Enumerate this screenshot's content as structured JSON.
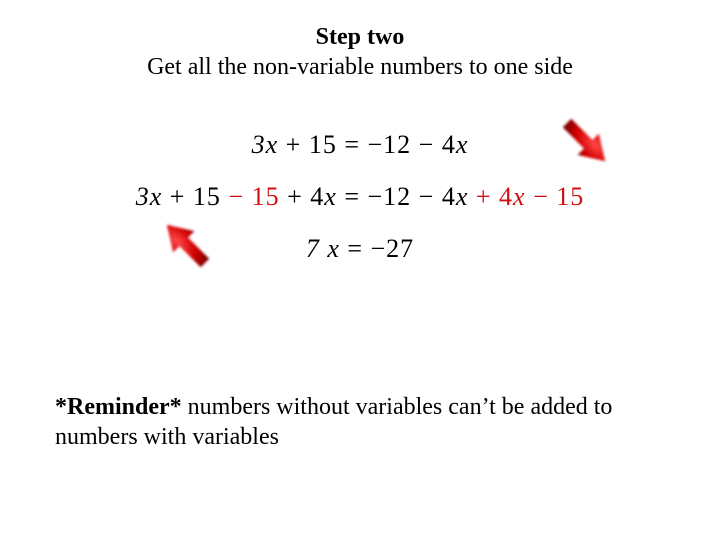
{
  "heading": {
    "title": "Step two",
    "subtitle": "Get all the non-variable numbers to one side"
  },
  "equations": {
    "line1": {
      "pre": "3",
      "x1": "x",
      "mid1": " + 15 = −12 − 4",
      "x2": "x"
    },
    "line2": {
      "a": "3",
      "x1": "x",
      "b": " + 15",
      "r1": " − 15",
      "c": " + 4",
      "x2": "x",
      "d": " = −12 − 4",
      "x3": "x",
      "r2": " + 4",
      "x4": "x",
      "r3": " − 15"
    },
    "line3": {
      "a": "7 ",
      "x1": "x",
      "b": " = −27"
    }
  },
  "reminder": {
    "label": "*Reminder*",
    "text": " numbers without variables can’t be added to numbers with variables"
  },
  "icons": {
    "arrow_top": "red-arrow-down-left",
    "arrow_bottom": "red-arrow-up-right"
  }
}
